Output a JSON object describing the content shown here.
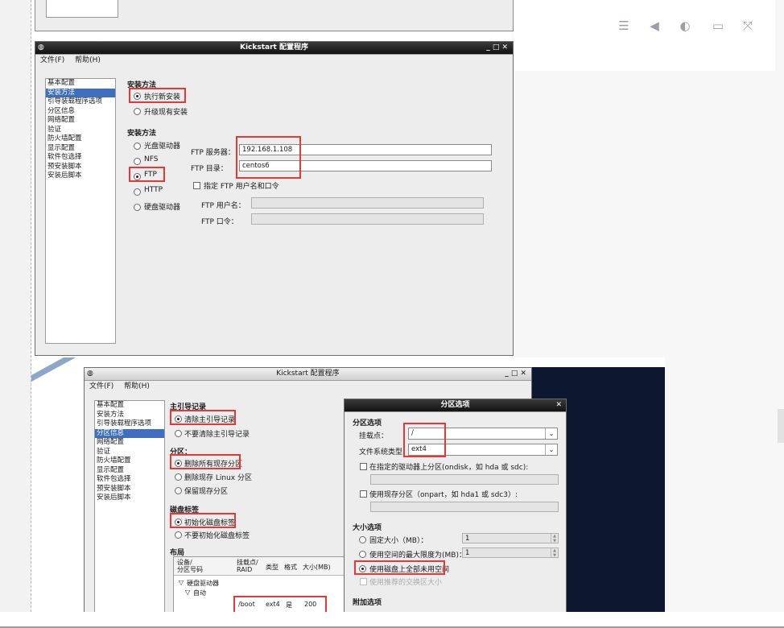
{
  "toolbar": {
    "icons": [
      "list-icon",
      "back-icon",
      "contrast-icon",
      "monitor-icon",
      "fullscreen-icon"
    ]
  },
  "win1": {
    "title": "Kickstart 配置程序",
    "menu": [
      "文件(F)",
      "帮助(H)"
    ],
    "nav": [
      "基本配置",
      "安装方法",
      "引导装载程序选项",
      "分区信息",
      "网络配置",
      "验证",
      "防火墙配置",
      "显示配置",
      "软件包选择",
      "预安装脚本",
      "安装后脚本"
    ],
    "nav_selected": 1,
    "section_install": "安装方法",
    "opt_new": "执行新安装",
    "opt_upgrade": "升级现有安装",
    "section_method": "安装方法",
    "methods": [
      "光盘驱动器",
      "NFS",
      "FTP",
      "HTTP",
      "硬盘驱动器"
    ],
    "ftp_server_label": "FTP 服务器：",
    "ftp_server_value": "192.168.1.108",
    "ftp_dir_label": "FTP 目录：",
    "ftp_dir_value": "centos6",
    "ftp_user_check": "指定 FTP 用户名和口令",
    "ftp_user_label": "FTP 用户名：",
    "ftp_pass_label": "FTP 口令："
  },
  "win2": {
    "title": "Kickstart 配置程序",
    "menu": [
      "文件(F)",
      "帮助(H)"
    ],
    "nav": [
      "基本配置",
      "安装方法",
      "引导装载程序选项",
      "分区信息",
      "网络配置",
      "验证",
      "防火墙配置",
      "显示配置",
      "软件包选择",
      "预安装脚本",
      "安装后脚本"
    ],
    "nav_selected": 3,
    "mbr_title": "主引导记录",
    "mbr_opts": [
      "清除主引导记录",
      "不要清除主引导记录"
    ],
    "part_title": "分区：",
    "part_opts": [
      "删除所有现存分区",
      "删除现存 Linux 分区",
      "保留现存分区"
    ],
    "label_title": "磁盘标签",
    "label_opts": [
      "初始化磁盘标签",
      "不要初始化磁盘标签"
    ],
    "layout_title": "布局",
    "table_headers": [
      "设备/\n分区号码",
      "挂载点/\nRAID",
      "类型",
      "格式",
      "大小(MB)"
    ],
    "tree": [
      "硬盘驱动器",
      "自动"
    ],
    "row": {
      "mount": "/boot",
      "type": "ext4",
      "format": "是",
      "size": "200"
    }
  },
  "dialog": {
    "title": "分区选项",
    "section_part": "分区选项",
    "mount_label": "挂载点：",
    "mount_value": "/",
    "fs_label": "文件系统类型：",
    "fs_value": "ext4",
    "check1": "在指定的驱动器上分区(ondisk，如 hda 或 sdc):",
    "check2": "使用现存分区（onpart，如 hda1 或 sdc3）:",
    "size_title": "大小选项",
    "size_opts": [
      "固定大小（MB）：",
      "使用空间的最大限度为(MB)：",
      "使用磁盘上全部未用空间"
    ],
    "spin_value": "1",
    "check3": "使用推荐的交换区大小",
    "extra_title": "附加选项"
  }
}
